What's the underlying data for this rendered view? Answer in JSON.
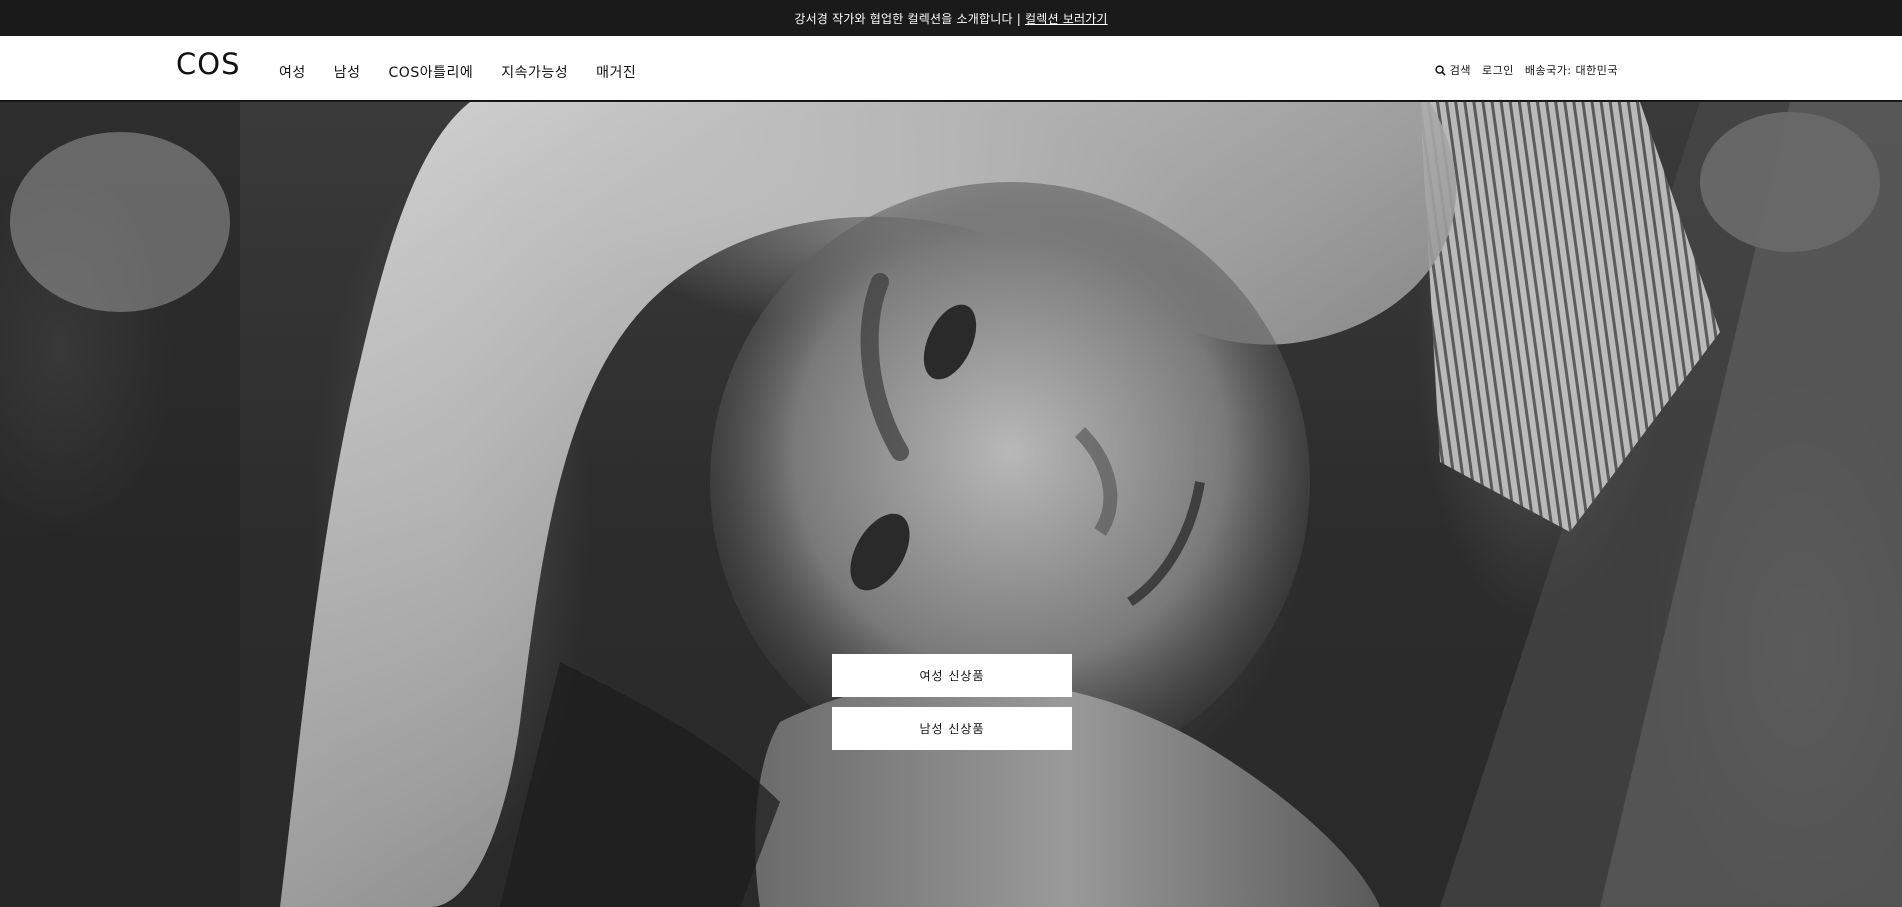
{
  "announcement": {
    "text": "강서경 작가와 협업한 컬렉션을 소개합니다 |",
    "link": "컬렉션 보러가기"
  },
  "header": {
    "logo": "COS",
    "nav": [
      "여성",
      "남성",
      "COS아틀리에",
      "지속가능성",
      "매거진"
    ],
    "search_label": "검색",
    "login_label": "로그인",
    "shipping_label": "배송국가: 대한민국",
    "search_icon": "search-icon"
  },
  "hero": {
    "image": "black-and-white portrait of a blonde woman resting her head on her arm",
    "cta_women": "여성 신상품",
    "cta_men": "남성 신상품"
  },
  "colors": {
    "announcement_bg": "#1a1a1a",
    "header_bg": "#ffffff",
    "text": "#111111",
    "button_bg": "#ffffff"
  }
}
